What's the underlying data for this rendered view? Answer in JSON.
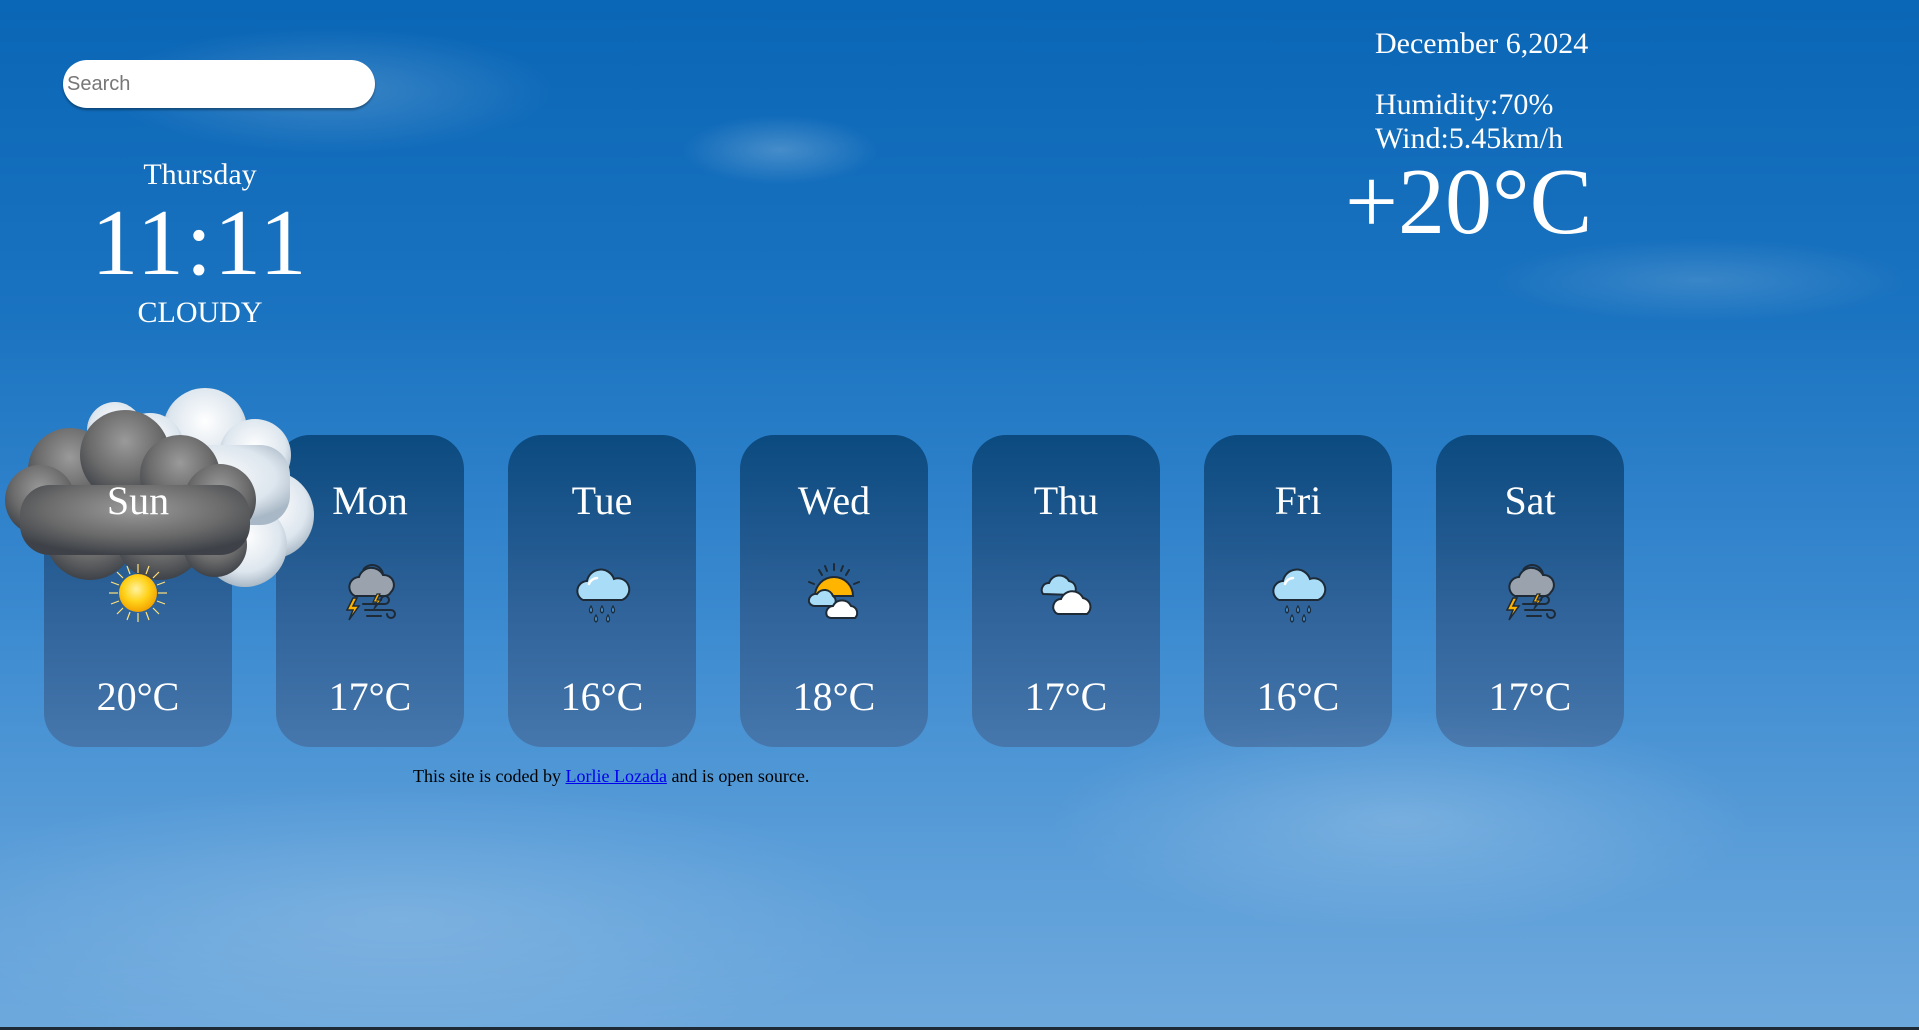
{
  "search": {
    "placeholder": "Search"
  },
  "current": {
    "day": "Thursday",
    "time": "11:11",
    "condition": "CLOUDY",
    "date": "December 6,2024",
    "humidity": "Humidity:70%",
    "wind": "Wind:5.45km/h",
    "temperature": "+20°C",
    "condition_icon": "cloudy-icon"
  },
  "forecast": [
    {
      "day": "Sun",
      "temp": "20°C",
      "icon": "sun-icon"
    },
    {
      "day": "Mon",
      "temp": "17°C",
      "icon": "thunderstorm-wind-icon"
    },
    {
      "day": "Tue",
      "temp": "16°C",
      "icon": "rain-cloud-icon"
    },
    {
      "day": "Wed",
      "temp": "18°C",
      "icon": "partly-sunny-icon"
    },
    {
      "day": "Thu",
      "temp": "17°C",
      "icon": "cloud-icon"
    },
    {
      "day": "Fri",
      "temp": "16°C",
      "icon": "rain-cloud-icon"
    },
    {
      "day": "Sat",
      "temp": "17°C",
      "icon": "thunderstorm-wind-icon"
    }
  ],
  "footer": {
    "prefix": "This site is coded by ",
    "link_text": "Lorlie Lozada",
    "suffix": " and is open source."
  },
  "colors": {
    "sky_top": "#0a66b6",
    "sky_bottom": "#6ea9dd",
    "card_bg": "#1f4a78",
    "link": "#0000ee",
    "sun": "#ffc21a",
    "lightning": "#ffb400",
    "rain": "#4aa3e8"
  }
}
